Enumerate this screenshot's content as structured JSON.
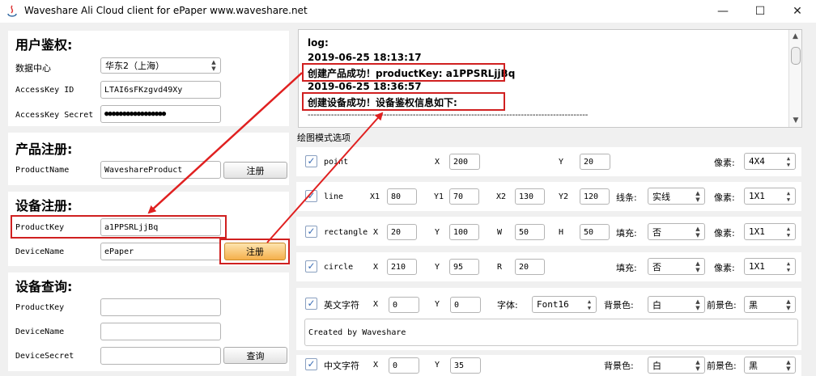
{
  "window": {
    "title": "Waveshare Ali Cloud client for ePaper  www.waveshare.net",
    "minimize": "—",
    "maximize": "☐",
    "close": "✕"
  },
  "auth": {
    "heading": "用户鉴权:",
    "datacenter_label": "数据中心",
    "datacenter_value": "华东2（上海）",
    "accesskey_id_label": "AccessKey ID",
    "accesskey_id_value": "LTAI6sFKzgvd49Xy",
    "accesskey_secret_label": "AccessKey Secret",
    "accesskey_secret_value": "●●●●●●●●●●●●●●●●●"
  },
  "product_reg": {
    "heading": "产品注册:",
    "name_label": "ProductName",
    "name_value": "WaveshareProduct",
    "register_button": "注册"
  },
  "device_reg": {
    "heading": "设备注册:",
    "key_label": "ProductKey",
    "key_value": "a1PPSRLjjBq",
    "device_label": "DeviceName",
    "device_value": "ePaper",
    "register_button": "注册"
  },
  "device_query": {
    "heading": "设备查询:",
    "key_label": "ProductKey",
    "device_label": "DeviceName",
    "secret_label": "DeviceSecret",
    "query_button": "查询"
  },
  "log": {
    "lines": [
      "log:",
      "2019-06-25 18:13:17",
      "创建产品成功！productKey: a1PPSRLjjBq",
      "2019-06-25 18:36:57",
      "创建设备成功！设备鉴权信息如下:",
      "------------------------------------------------------------------------------------------------"
    ]
  },
  "draw": {
    "heading": "绘图模式选项",
    "point": {
      "name": "point",
      "x_label": "X",
      "x": "200",
      "y_label": "Y",
      "y": "20",
      "pixel_label": "像素:",
      "pixel": "4X4"
    },
    "line": {
      "name": "line",
      "x1_label": "X1",
      "x1": "80",
      "y1_label": "Y1",
      "y1": "70",
      "x2_label": "X2",
      "x2": "130",
      "y2_label": "Y2",
      "y2": "120",
      "style_label": "线条:",
      "style": "实线",
      "pixel_label": "像素:",
      "pixel": "1X1"
    },
    "rectangle": {
      "name": "rectangle",
      "x_label": "X",
      "x": "20",
      "y_label": "Y",
      "y": "100",
      "w_label": "W",
      "w": "50",
      "h_label": "H",
      "h": "50",
      "fill_label": "填充:",
      "fill": "否",
      "pixel_label": "像素:",
      "pixel": "1X1"
    },
    "circle": {
      "name": "circle",
      "x_label": "X",
      "x": "210",
      "y_label": "Y",
      "y": "95",
      "r_label": "R",
      "r": "20",
      "fill_label": "填充:",
      "fill": "否",
      "pixel_label": "像素:",
      "pixel": "1X1"
    },
    "en_text": {
      "name": "英文字符",
      "x_label": "X",
      "x": "0",
      "y_label": "Y",
      "y": "0",
      "font_label": "字体:",
      "font": "Font16",
      "bg_label": "背景色:",
      "bg": "白",
      "fg_label": "前景色:",
      "fg": "黑",
      "text": "Created by Waveshare"
    },
    "cn_text": {
      "name": "中文字符",
      "x_label": "X",
      "x": "0",
      "y_label": "Y",
      "y": "35",
      "bg_label": "背景色:",
      "bg": "白",
      "fg_label": "前景色:",
      "fg": "黑"
    }
  }
}
